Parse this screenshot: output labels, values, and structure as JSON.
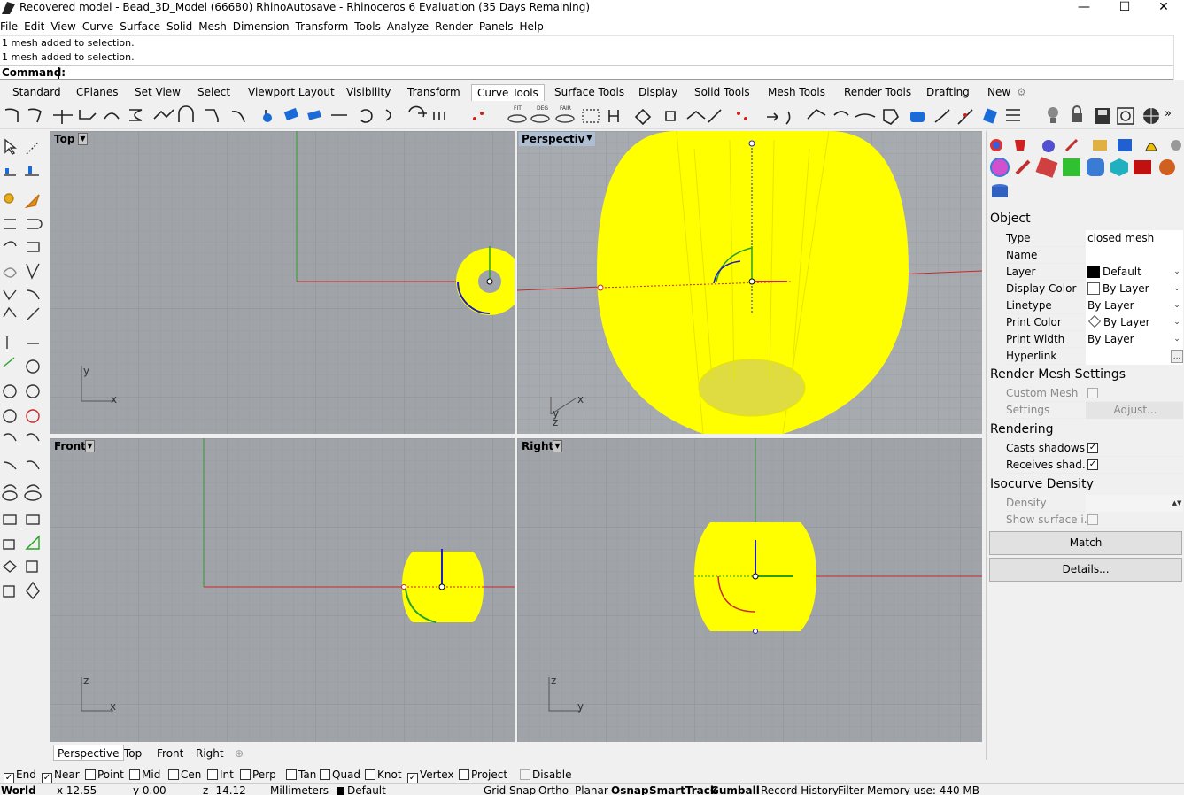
{
  "window": {
    "title": "Recovered model - Bead_3D_Model (66680) RhinoAutosave - Rhinoceros 6 Evaluation (35 Days Remaining)",
    "min": "—",
    "max": "☐",
    "close": "✕"
  },
  "menu": [
    "File",
    "Edit",
    "View",
    "Curve",
    "Surface",
    "Solid",
    "Mesh",
    "Dimension",
    "Transform",
    "Tools",
    "Analyze",
    "Render",
    "Panels",
    "Help"
  ],
  "history": [
    "1 mesh added to selection.",
    "1 mesh added to selection."
  ],
  "command": {
    "label": "Command:",
    "value": ""
  },
  "toolbar_tabs": [
    "Standard",
    "CPlanes",
    "Set View",
    "Select",
    "Viewport Layout",
    "Visibility",
    "Transform",
    "Curve Tools",
    "Surface Tools",
    "Display",
    "Solid Tools",
    "Mesh Tools",
    "Render Tools",
    "Drafting",
    "New"
  ],
  "toolbar_active_tab": "Curve Tools",
  "toolbar_more": "»",
  "viewports": {
    "top": {
      "label": "Top",
      "ax1": "y",
      "ax2": "x"
    },
    "perspective": {
      "label": "Perspective",
      "ax1": "y",
      "ax2": "x",
      "ax3": "z"
    },
    "front": {
      "label": "Front",
      "ax1": "z",
      "ax2": "x"
    },
    "right": {
      "label": "Right",
      "ax1": "z",
      "ax2": "y"
    }
  },
  "viewport_tabs": [
    "Perspective",
    "Top",
    "Front",
    "Right"
  ],
  "viewport_add": "⊕",
  "osnaps": [
    {
      "label": "End",
      "checked": true
    },
    {
      "label": "Near",
      "checked": true
    },
    {
      "label": "Point",
      "checked": false
    },
    {
      "label": "Mid",
      "checked": false
    },
    {
      "label": "Cen",
      "checked": false
    },
    {
      "label": "Int",
      "checked": false
    },
    {
      "label": "Perp",
      "checked": false
    },
    {
      "label": "Tan",
      "checked": false
    },
    {
      "label": "Quad",
      "checked": false
    },
    {
      "label": "Knot",
      "checked": false
    },
    {
      "label": "Vertex",
      "checked": true
    },
    {
      "label": "Project",
      "checked": false
    },
    {
      "label": "Disable",
      "checked": false
    }
  ],
  "status": {
    "cplane": "World",
    "x": "x 12.55",
    "y": "y 0.00",
    "z": "z -14.12",
    "units": "Millimeters",
    "layer": "Default",
    "toggles": [
      "Grid Snap",
      "Ortho",
      "Planar",
      "Osnap",
      "SmartTrack",
      "Gumball",
      "Record History",
      "Filter"
    ],
    "memory": "Memory use: 440 MB"
  },
  "properties": {
    "object_header": "Object",
    "rows": [
      {
        "k": "Type",
        "v": "closed mesh"
      },
      {
        "k": "Name",
        "v": ""
      },
      {
        "k": "Layer",
        "v": "Default"
      },
      {
        "k": "Display Color",
        "v": "By Layer"
      },
      {
        "k": "Linetype",
        "v": "By Layer"
      },
      {
        "k": "Print Color",
        "v": "By Layer"
      },
      {
        "k": "Print Width",
        "v": "By Layer"
      },
      {
        "k": "Hyperlink",
        "v": "",
        "more": "..."
      }
    ],
    "render_mesh_header": "Render Mesh Settings",
    "custom_mesh": "Custom Mesh",
    "settings": "Settings",
    "adjust": "Adjust...",
    "rendering_header": "Rendering",
    "casts": "Casts shadows",
    "receives": "Receives shad...",
    "iso_header": "Isocurve Density",
    "density": "Density",
    "show_surface": "Show surface i...",
    "match": "Match",
    "details": "Details..."
  },
  "colors": {
    "mesh": "#ffff00",
    "xaxis": "#c82828",
    "yaxis": "#28a028",
    "gumball_z": "#1e1ec8",
    "viewport_bg": "#a0a4a9"
  }
}
